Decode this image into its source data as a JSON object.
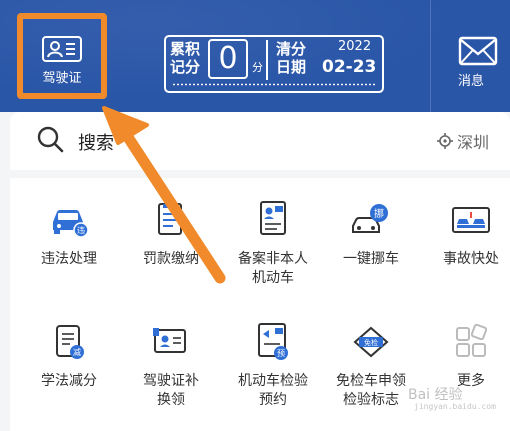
{
  "header": {
    "license_label": "驾驶证",
    "score": {
      "label": "累积记分",
      "value": "0",
      "unit": "分",
      "clear_label": "清分日期",
      "year": "2022",
      "date": "02-23"
    },
    "message_label": "消息"
  },
  "search": {
    "placeholder": "搜索",
    "location": "深圳"
  },
  "grid": [
    {
      "label": "违法处理",
      "icon": "car-violation-icon"
    },
    {
      "label": "罚款缴纳",
      "icon": "fine-payment-icon"
    },
    {
      "label": "备案非本人机动车",
      "icon": "vehicle-filing-icon"
    },
    {
      "label": "一键挪车",
      "icon": "move-car-icon"
    },
    {
      "label": "事故快处",
      "icon": "accident-icon"
    },
    {
      "label": "学法减分",
      "icon": "study-reduce-points-icon"
    },
    {
      "label": "驾驶证补换领",
      "icon": "license-reissue-icon"
    },
    {
      "label": "机动车检验预约",
      "icon": "inspection-appointment-icon"
    },
    {
      "label": "免检车申领检验标志",
      "icon": "exempt-inspection-icon"
    },
    {
      "label": "更多",
      "icon": "more-apps-icon"
    }
  ],
  "watermark": {
    "text": "Bai 经验",
    "sub": "jingyan.baidu.com"
  },
  "colors": {
    "header_bg": "#2a56a8",
    "highlight": "#f08a2a",
    "icon_blue": "#2f6fd6"
  }
}
